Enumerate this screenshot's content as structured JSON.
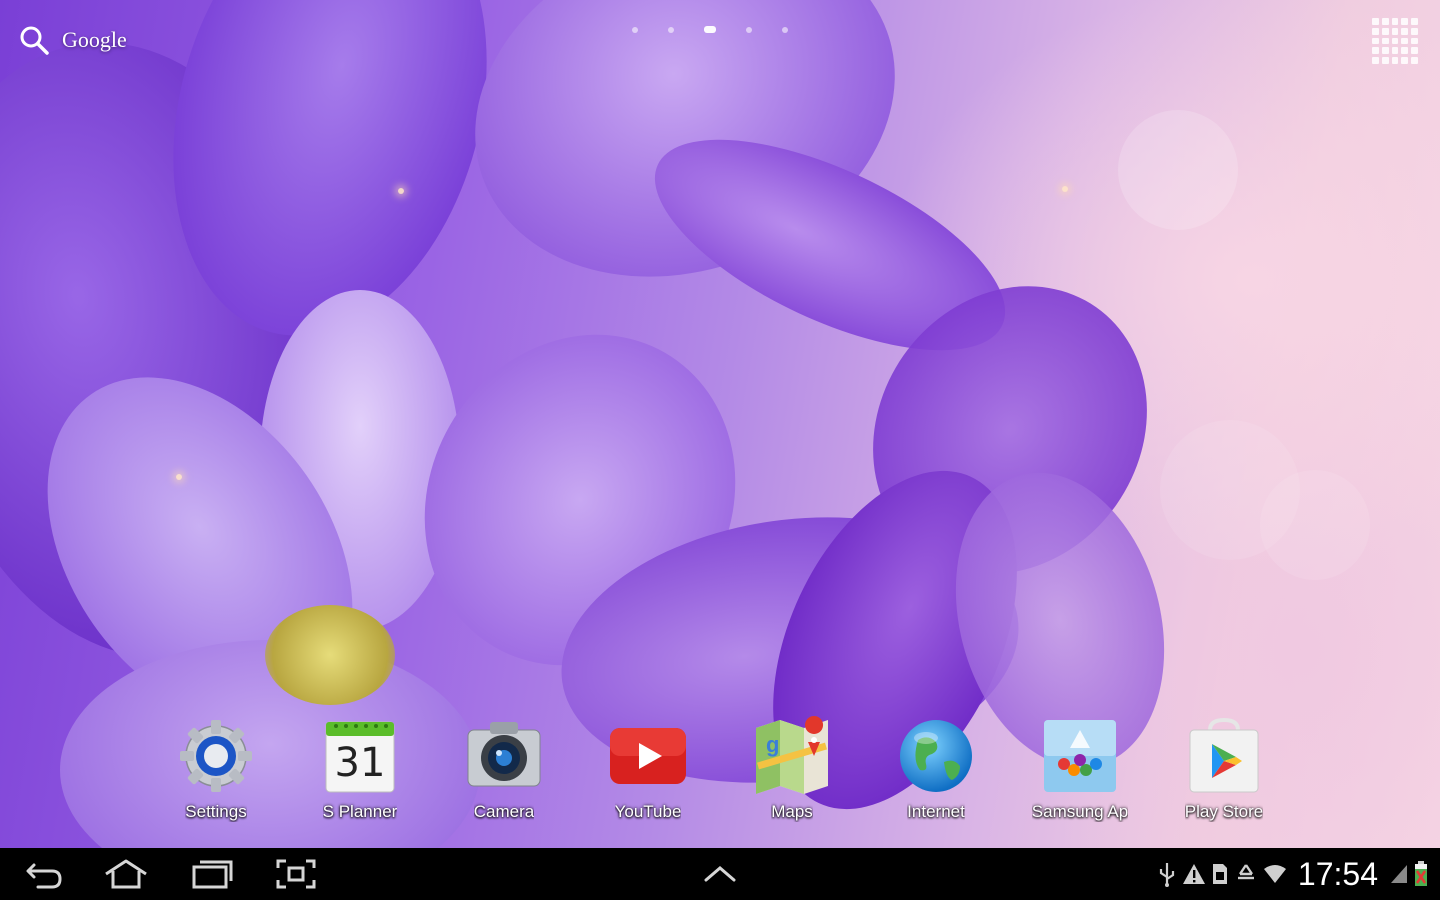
{
  "search": {
    "label": "Google"
  },
  "pages": {
    "count": 5,
    "active": 2
  },
  "dock": {
    "apps": [
      {
        "label": "Settings",
        "icon": "settings-icon"
      },
      {
        "label": "S Planner",
        "icon": "calendar-icon",
        "day": "31"
      },
      {
        "label": "Camera",
        "icon": "camera-icon"
      },
      {
        "label": "YouTube",
        "icon": "youtube-icon"
      },
      {
        "label": "Maps",
        "icon": "maps-icon"
      },
      {
        "label": "Internet",
        "icon": "globe-icon"
      },
      {
        "label": "Samsung Ap",
        "icon": "samsung-apps-icon"
      },
      {
        "label": "Play Store",
        "icon": "play-store-icon"
      }
    ]
  },
  "status_bar": {
    "time": "17:54"
  },
  "colors": {
    "navbar": "#000000",
    "wallpaper_purple": "#8b52dc",
    "wallpaper_pink": "#f6d6e4"
  }
}
